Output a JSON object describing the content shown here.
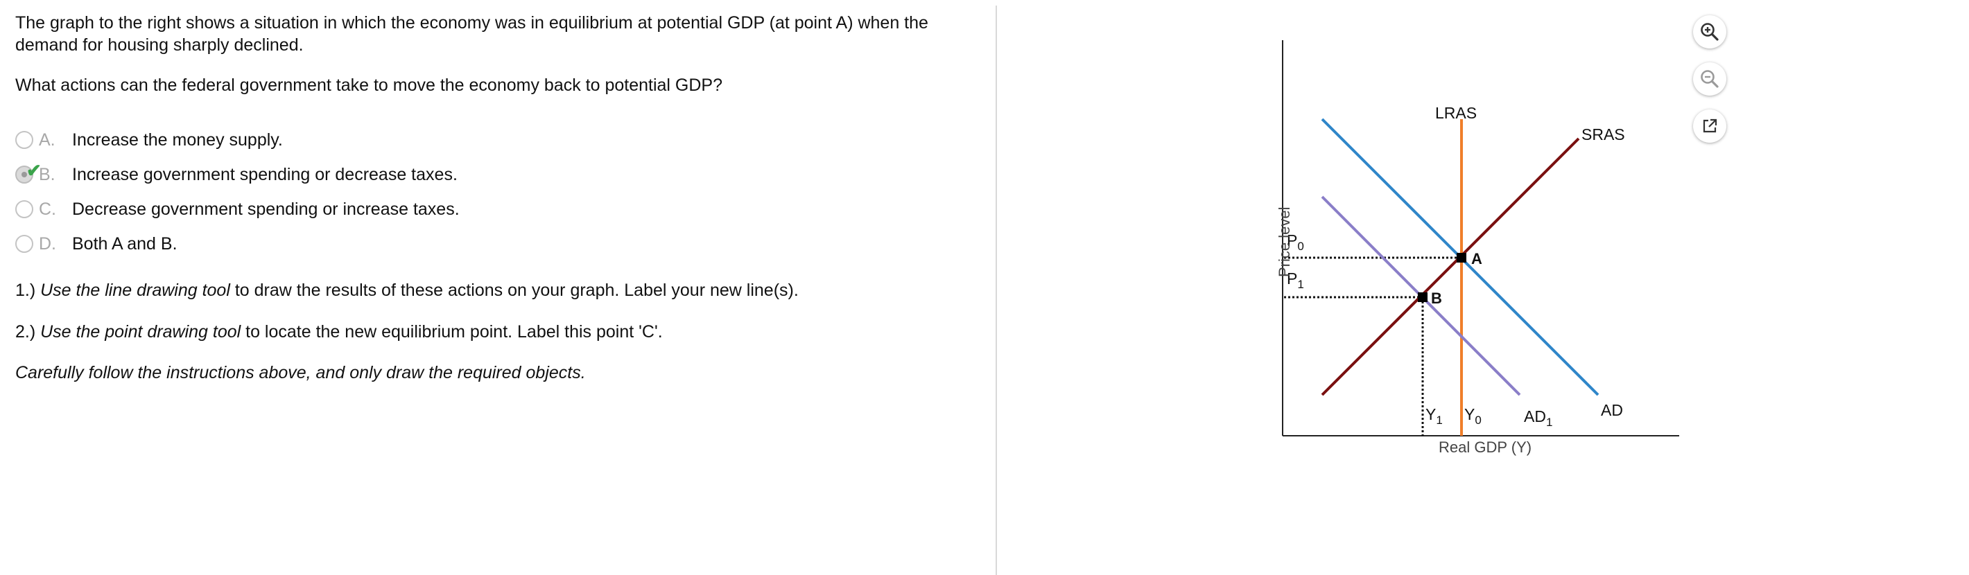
{
  "question": {
    "paragraph1_line1": "The graph to the right shows a situation in which the economy was in equilibrium at potential GDP (at point A) when the",
    "paragraph1_line2": "demand for housing sharply declined.",
    "paragraph2": "What actions can the federal government take to move the economy back to potential GDP?"
  },
  "options": [
    {
      "letter": "A.",
      "text": "Increase the money supply.",
      "selected": false
    },
    {
      "letter": "B.",
      "text": "Increase government spending or decrease taxes.",
      "selected": true
    },
    {
      "letter": "C.",
      "text": "Decrease government spending or increase taxes.",
      "selected": false
    },
    {
      "letter": "D.",
      "text": "Both A and B.",
      "selected": false
    }
  ],
  "instructions": {
    "i1_prefix": "1.) ",
    "i1_italic": "Use the line drawing tool",
    "i1_rest": " to draw the results of these actions on your graph. Label your new line(s).",
    "i2_prefix": "2.) ",
    "i2_italic": "Use the point drawing tool",
    "i2_rest": " to locate the new equilibrium point. Label this point 'C'.",
    "i3": "Carefully follow the instructions above, and only draw the required objects."
  },
  "graph": {
    "ylabel": "Price level",
    "xlabel": "Real GDP (Y)",
    "lras": "LRAS",
    "sras": "SRAS",
    "ad": "AD",
    "ad1": "AD",
    "ad1_sub": "1",
    "p0": "P",
    "p0_sub": "0",
    "p1": "P",
    "p1_sub": "1",
    "y0": "Y",
    "y0_sub": "0",
    "y1": "Y",
    "y1_sub": "1",
    "point_a": "A",
    "point_b": "B",
    "colors": {
      "lras": "#f07f2a",
      "sras": "#7a1010",
      "ad": "#2f86c9",
      "ad1": "#8a7ec8"
    }
  },
  "tools": [
    {
      "icon": "zoom-in-icon"
    },
    {
      "icon": "zoom-out-icon"
    },
    {
      "icon": "external-link-icon"
    }
  ]
}
